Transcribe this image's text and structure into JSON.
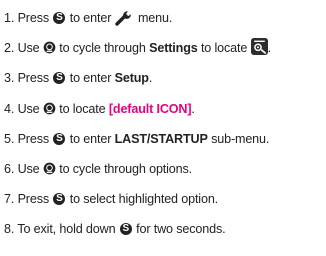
{
  "instructions": {
    "step1": {
      "num": "1.",
      "t1": "Press",
      "btn": "S",
      "t2": "to enter",
      "t3": "menu."
    },
    "step2": {
      "num": "2.",
      "t1": "Use",
      "t2": "to cycle through",
      "bold": "Settings",
      "t3": "to locate",
      "t4": "."
    },
    "step3": {
      "num": "3.",
      "t1": "Press",
      "btn": "S",
      "t2": "to enter",
      "bold": "Setup",
      "t3": "."
    },
    "step4": {
      "num": "4.",
      "t1": "Use",
      "t2": "to locate",
      "highlight": "[default ICON]",
      "t3": "."
    },
    "step5": {
      "num": "5.",
      "t1": "Press",
      "btn": "S",
      "t2": "to enter",
      "bold": "LAST/STARTUP",
      "t3": "sub-menu."
    },
    "step6": {
      "num": "6.",
      "t1": "Use",
      "t2": "to cycle through options."
    },
    "step7": {
      "num": "7.",
      "t1": "Press",
      "btn": "S",
      "t2": "to select highlighted option."
    },
    "step8": {
      "num": "8.",
      "t1": "To exit, hold down",
      "btn": "S",
      "t2": "for two seconds."
    }
  },
  "icons": {
    "select_button": "select-button-icon",
    "wrench": "wrench-icon",
    "knob": "dial-knob-icon",
    "settings": "settings-tile-icon"
  },
  "colors": {
    "text": "#222222",
    "highlight": "#e6007e"
  }
}
